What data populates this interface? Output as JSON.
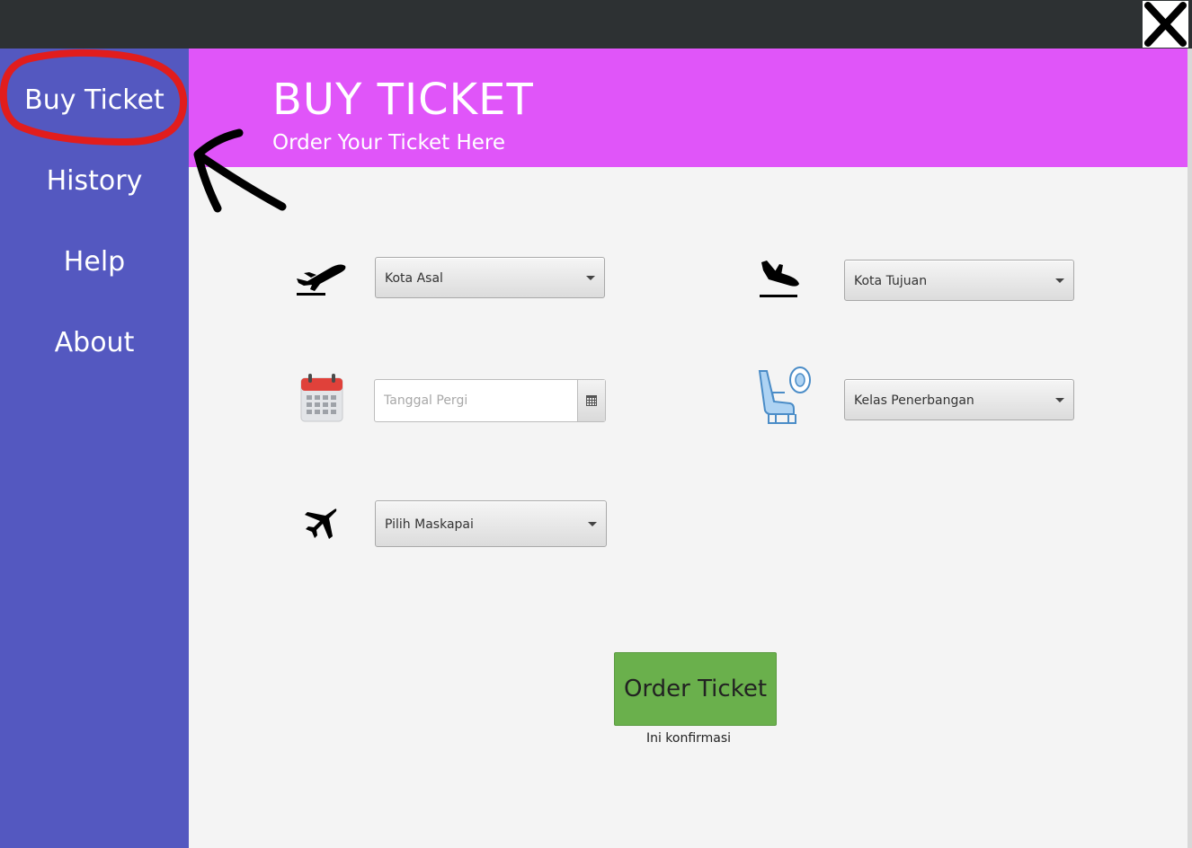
{
  "nav": {
    "items": [
      "Buy Ticket",
      "History",
      "Help",
      "About"
    ]
  },
  "header": {
    "title": "BUY TICKET",
    "subtitle": "Order Your Ticket Here"
  },
  "form": {
    "origin_label": "Kota Asal",
    "destination_label": "Kota Tujuan",
    "date_placeholder": "Tanggal Pergi",
    "class_label": "Kelas Penerbangan",
    "airline_label": "Pilih Maskapai"
  },
  "actions": {
    "order_label": "Order Ticket",
    "confirm_text": "Ini konfirmasi"
  },
  "icons": {
    "close": "close-icon",
    "departure": "takeoff-icon",
    "arrival": "landing-icon",
    "date": "calendar-icon",
    "class": "seat-icon",
    "airline": "airplane-icon"
  },
  "colors": {
    "sidebar": "#5458c0",
    "header": "#e055f9",
    "titlebar": "#2d3133",
    "order_button": "#6ab04c",
    "annotation_red": "#e11d1d"
  }
}
